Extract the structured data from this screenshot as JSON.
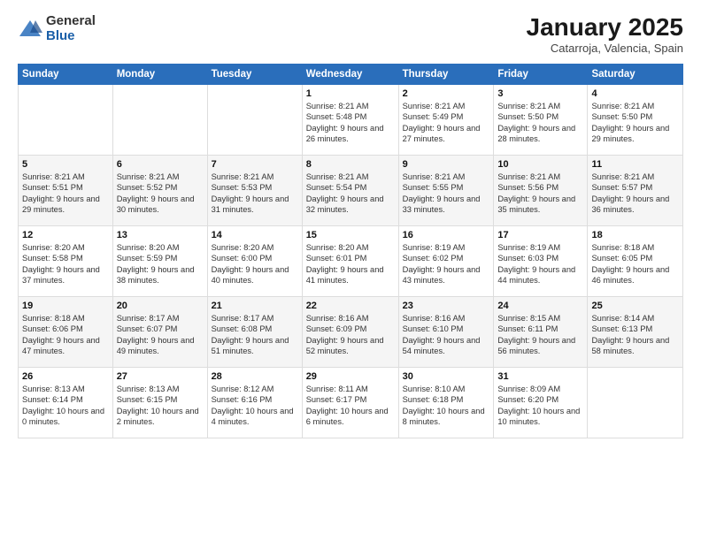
{
  "header": {
    "logo_general": "General",
    "logo_blue": "Blue",
    "month_title": "January 2025",
    "location": "Catarroja, Valencia, Spain"
  },
  "weekdays": [
    "Sunday",
    "Monday",
    "Tuesday",
    "Wednesday",
    "Thursday",
    "Friday",
    "Saturday"
  ],
  "weeks": [
    [
      {
        "day": "",
        "sunrise": "",
        "sunset": "",
        "daylight": ""
      },
      {
        "day": "",
        "sunrise": "",
        "sunset": "",
        "daylight": ""
      },
      {
        "day": "",
        "sunrise": "",
        "sunset": "",
        "daylight": ""
      },
      {
        "day": "1",
        "sunrise": "Sunrise: 8:21 AM",
        "sunset": "Sunset: 5:48 PM",
        "daylight": "Daylight: 9 hours and 26 minutes."
      },
      {
        "day": "2",
        "sunrise": "Sunrise: 8:21 AM",
        "sunset": "Sunset: 5:49 PM",
        "daylight": "Daylight: 9 hours and 27 minutes."
      },
      {
        "day": "3",
        "sunrise": "Sunrise: 8:21 AM",
        "sunset": "Sunset: 5:50 PM",
        "daylight": "Daylight: 9 hours and 28 minutes."
      },
      {
        "day": "4",
        "sunrise": "Sunrise: 8:21 AM",
        "sunset": "Sunset: 5:50 PM",
        "daylight": "Daylight: 9 hours and 29 minutes."
      }
    ],
    [
      {
        "day": "5",
        "sunrise": "Sunrise: 8:21 AM",
        "sunset": "Sunset: 5:51 PM",
        "daylight": "Daylight: 9 hours and 29 minutes."
      },
      {
        "day": "6",
        "sunrise": "Sunrise: 8:21 AM",
        "sunset": "Sunset: 5:52 PM",
        "daylight": "Daylight: 9 hours and 30 minutes."
      },
      {
        "day": "7",
        "sunrise": "Sunrise: 8:21 AM",
        "sunset": "Sunset: 5:53 PM",
        "daylight": "Daylight: 9 hours and 31 minutes."
      },
      {
        "day": "8",
        "sunrise": "Sunrise: 8:21 AM",
        "sunset": "Sunset: 5:54 PM",
        "daylight": "Daylight: 9 hours and 32 minutes."
      },
      {
        "day": "9",
        "sunrise": "Sunrise: 8:21 AM",
        "sunset": "Sunset: 5:55 PM",
        "daylight": "Daylight: 9 hours and 33 minutes."
      },
      {
        "day": "10",
        "sunrise": "Sunrise: 8:21 AM",
        "sunset": "Sunset: 5:56 PM",
        "daylight": "Daylight: 9 hours and 35 minutes."
      },
      {
        "day": "11",
        "sunrise": "Sunrise: 8:21 AM",
        "sunset": "Sunset: 5:57 PM",
        "daylight": "Daylight: 9 hours and 36 minutes."
      }
    ],
    [
      {
        "day": "12",
        "sunrise": "Sunrise: 8:20 AM",
        "sunset": "Sunset: 5:58 PM",
        "daylight": "Daylight: 9 hours and 37 minutes."
      },
      {
        "day": "13",
        "sunrise": "Sunrise: 8:20 AM",
        "sunset": "Sunset: 5:59 PM",
        "daylight": "Daylight: 9 hours and 38 minutes."
      },
      {
        "day": "14",
        "sunrise": "Sunrise: 8:20 AM",
        "sunset": "Sunset: 6:00 PM",
        "daylight": "Daylight: 9 hours and 40 minutes."
      },
      {
        "day": "15",
        "sunrise": "Sunrise: 8:20 AM",
        "sunset": "Sunset: 6:01 PM",
        "daylight": "Daylight: 9 hours and 41 minutes."
      },
      {
        "day": "16",
        "sunrise": "Sunrise: 8:19 AM",
        "sunset": "Sunset: 6:02 PM",
        "daylight": "Daylight: 9 hours and 43 minutes."
      },
      {
        "day": "17",
        "sunrise": "Sunrise: 8:19 AM",
        "sunset": "Sunset: 6:03 PM",
        "daylight": "Daylight: 9 hours and 44 minutes."
      },
      {
        "day": "18",
        "sunrise": "Sunrise: 8:18 AM",
        "sunset": "Sunset: 6:05 PM",
        "daylight": "Daylight: 9 hours and 46 minutes."
      }
    ],
    [
      {
        "day": "19",
        "sunrise": "Sunrise: 8:18 AM",
        "sunset": "Sunset: 6:06 PM",
        "daylight": "Daylight: 9 hours and 47 minutes."
      },
      {
        "day": "20",
        "sunrise": "Sunrise: 8:17 AM",
        "sunset": "Sunset: 6:07 PM",
        "daylight": "Daylight: 9 hours and 49 minutes."
      },
      {
        "day": "21",
        "sunrise": "Sunrise: 8:17 AM",
        "sunset": "Sunset: 6:08 PM",
        "daylight": "Daylight: 9 hours and 51 minutes."
      },
      {
        "day": "22",
        "sunrise": "Sunrise: 8:16 AM",
        "sunset": "Sunset: 6:09 PM",
        "daylight": "Daylight: 9 hours and 52 minutes."
      },
      {
        "day": "23",
        "sunrise": "Sunrise: 8:16 AM",
        "sunset": "Sunset: 6:10 PM",
        "daylight": "Daylight: 9 hours and 54 minutes."
      },
      {
        "day": "24",
        "sunrise": "Sunrise: 8:15 AM",
        "sunset": "Sunset: 6:11 PM",
        "daylight": "Daylight: 9 hours and 56 minutes."
      },
      {
        "day": "25",
        "sunrise": "Sunrise: 8:14 AM",
        "sunset": "Sunset: 6:13 PM",
        "daylight": "Daylight: 9 hours and 58 minutes."
      }
    ],
    [
      {
        "day": "26",
        "sunrise": "Sunrise: 8:13 AM",
        "sunset": "Sunset: 6:14 PM",
        "daylight": "Daylight: 10 hours and 0 minutes."
      },
      {
        "day": "27",
        "sunrise": "Sunrise: 8:13 AM",
        "sunset": "Sunset: 6:15 PM",
        "daylight": "Daylight: 10 hours and 2 minutes."
      },
      {
        "day": "28",
        "sunrise": "Sunrise: 8:12 AM",
        "sunset": "Sunset: 6:16 PM",
        "daylight": "Daylight: 10 hours and 4 minutes."
      },
      {
        "day": "29",
        "sunrise": "Sunrise: 8:11 AM",
        "sunset": "Sunset: 6:17 PM",
        "daylight": "Daylight: 10 hours and 6 minutes."
      },
      {
        "day": "30",
        "sunrise": "Sunrise: 8:10 AM",
        "sunset": "Sunset: 6:18 PM",
        "daylight": "Daylight: 10 hours and 8 minutes."
      },
      {
        "day": "31",
        "sunrise": "Sunrise: 8:09 AM",
        "sunset": "Sunset: 6:20 PM",
        "daylight": "Daylight: 10 hours and 10 minutes."
      },
      {
        "day": "",
        "sunrise": "",
        "sunset": "",
        "daylight": ""
      }
    ]
  ]
}
